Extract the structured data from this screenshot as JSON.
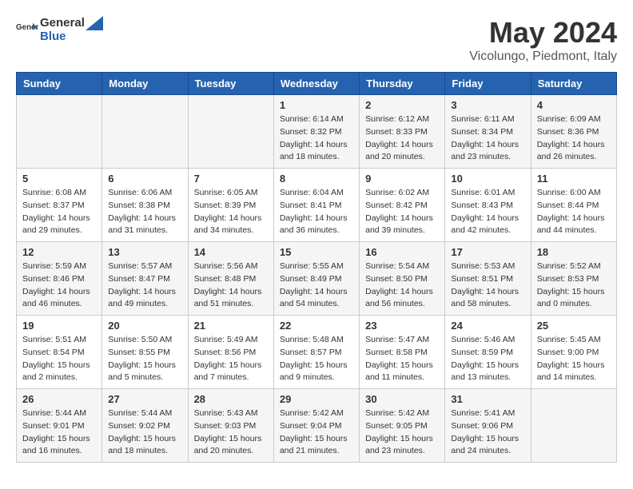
{
  "header": {
    "logo_text_general": "General",
    "logo_text_blue": "Blue",
    "month_year": "May 2024",
    "location": "Vicolungo, Piedmont, Italy"
  },
  "days_of_week": [
    "Sunday",
    "Monday",
    "Tuesday",
    "Wednesday",
    "Thursday",
    "Friday",
    "Saturday"
  ],
  "weeks": [
    [
      {
        "day": "",
        "info": ""
      },
      {
        "day": "",
        "info": ""
      },
      {
        "day": "",
        "info": ""
      },
      {
        "day": "1",
        "info": "Sunrise: 6:14 AM\nSunset: 8:32 PM\nDaylight: 14 hours\nand 18 minutes."
      },
      {
        "day": "2",
        "info": "Sunrise: 6:12 AM\nSunset: 8:33 PM\nDaylight: 14 hours\nand 20 minutes."
      },
      {
        "day": "3",
        "info": "Sunrise: 6:11 AM\nSunset: 8:34 PM\nDaylight: 14 hours\nand 23 minutes."
      },
      {
        "day": "4",
        "info": "Sunrise: 6:09 AM\nSunset: 8:36 PM\nDaylight: 14 hours\nand 26 minutes."
      }
    ],
    [
      {
        "day": "5",
        "info": "Sunrise: 6:08 AM\nSunset: 8:37 PM\nDaylight: 14 hours\nand 29 minutes."
      },
      {
        "day": "6",
        "info": "Sunrise: 6:06 AM\nSunset: 8:38 PM\nDaylight: 14 hours\nand 31 minutes."
      },
      {
        "day": "7",
        "info": "Sunrise: 6:05 AM\nSunset: 8:39 PM\nDaylight: 14 hours\nand 34 minutes."
      },
      {
        "day": "8",
        "info": "Sunrise: 6:04 AM\nSunset: 8:41 PM\nDaylight: 14 hours\nand 36 minutes."
      },
      {
        "day": "9",
        "info": "Sunrise: 6:02 AM\nSunset: 8:42 PM\nDaylight: 14 hours\nand 39 minutes."
      },
      {
        "day": "10",
        "info": "Sunrise: 6:01 AM\nSunset: 8:43 PM\nDaylight: 14 hours\nand 42 minutes."
      },
      {
        "day": "11",
        "info": "Sunrise: 6:00 AM\nSunset: 8:44 PM\nDaylight: 14 hours\nand 44 minutes."
      }
    ],
    [
      {
        "day": "12",
        "info": "Sunrise: 5:59 AM\nSunset: 8:46 PM\nDaylight: 14 hours\nand 46 minutes."
      },
      {
        "day": "13",
        "info": "Sunrise: 5:57 AM\nSunset: 8:47 PM\nDaylight: 14 hours\nand 49 minutes."
      },
      {
        "day": "14",
        "info": "Sunrise: 5:56 AM\nSunset: 8:48 PM\nDaylight: 14 hours\nand 51 minutes."
      },
      {
        "day": "15",
        "info": "Sunrise: 5:55 AM\nSunset: 8:49 PM\nDaylight: 14 hours\nand 54 minutes."
      },
      {
        "day": "16",
        "info": "Sunrise: 5:54 AM\nSunset: 8:50 PM\nDaylight: 14 hours\nand 56 minutes."
      },
      {
        "day": "17",
        "info": "Sunrise: 5:53 AM\nSunset: 8:51 PM\nDaylight: 14 hours\nand 58 minutes."
      },
      {
        "day": "18",
        "info": "Sunrise: 5:52 AM\nSunset: 8:53 PM\nDaylight: 15 hours\nand 0 minutes."
      }
    ],
    [
      {
        "day": "19",
        "info": "Sunrise: 5:51 AM\nSunset: 8:54 PM\nDaylight: 15 hours\nand 2 minutes."
      },
      {
        "day": "20",
        "info": "Sunrise: 5:50 AM\nSunset: 8:55 PM\nDaylight: 15 hours\nand 5 minutes."
      },
      {
        "day": "21",
        "info": "Sunrise: 5:49 AM\nSunset: 8:56 PM\nDaylight: 15 hours\nand 7 minutes."
      },
      {
        "day": "22",
        "info": "Sunrise: 5:48 AM\nSunset: 8:57 PM\nDaylight: 15 hours\nand 9 minutes."
      },
      {
        "day": "23",
        "info": "Sunrise: 5:47 AM\nSunset: 8:58 PM\nDaylight: 15 hours\nand 11 minutes."
      },
      {
        "day": "24",
        "info": "Sunrise: 5:46 AM\nSunset: 8:59 PM\nDaylight: 15 hours\nand 13 minutes."
      },
      {
        "day": "25",
        "info": "Sunrise: 5:45 AM\nSunset: 9:00 PM\nDaylight: 15 hours\nand 14 minutes."
      }
    ],
    [
      {
        "day": "26",
        "info": "Sunrise: 5:44 AM\nSunset: 9:01 PM\nDaylight: 15 hours\nand 16 minutes."
      },
      {
        "day": "27",
        "info": "Sunrise: 5:44 AM\nSunset: 9:02 PM\nDaylight: 15 hours\nand 18 minutes."
      },
      {
        "day": "28",
        "info": "Sunrise: 5:43 AM\nSunset: 9:03 PM\nDaylight: 15 hours\nand 20 minutes."
      },
      {
        "day": "29",
        "info": "Sunrise: 5:42 AM\nSunset: 9:04 PM\nDaylight: 15 hours\nand 21 minutes."
      },
      {
        "day": "30",
        "info": "Sunrise: 5:42 AM\nSunset: 9:05 PM\nDaylight: 15 hours\nand 23 minutes."
      },
      {
        "day": "31",
        "info": "Sunrise: 5:41 AM\nSunset: 9:06 PM\nDaylight: 15 hours\nand 24 minutes."
      },
      {
        "day": "",
        "info": ""
      }
    ]
  ]
}
